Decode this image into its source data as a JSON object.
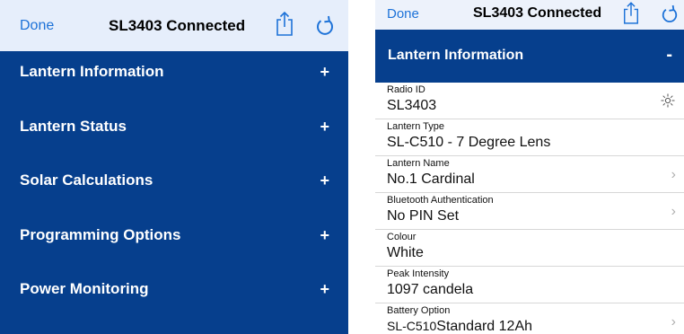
{
  "left": {
    "navbar": {
      "done": "Done",
      "title": "SL3403 Connected"
    },
    "sections": [
      {
        "label": "Lantern Information",
        "toggle": "+"
      },
      {
        "label": "Lantern Status",
        "toggle": "+"
      },
      {
        "label": "Solar Calculations",
        "toggle": "+"
      },
      {
        "label": "Programming Options",
        "toggle": "+"
      },
      {
        "label": "Power Monitoring",
        "toggle": "+"
      }
    ]
  },
  "right": {
    "navbar": {
      "done": "Done",
      "title": "SL3403 Connected"
    },
    "section": {
      "label": "Lantern Information",
      "toggle": "-"
    },
    "rows": [
      {
        "label": "Radio ID",
        "value": "SL3403",
        "accessory": "sun-icon"
      },
      {
        "label": "Lantern Type",
        "value": "SL-C510 - 7 Degree Lens"
      },
      {
        "label": "Lantern Name",
        "value": "No.1 Cardinal",
        "accessory": "chevron-right-icon"
      },
      {
        "label": "Bluetooth Authentication",
        "value": "No PIN Set",
        "accessory": "chevron-right-icon"
      },
      {
        "label": "Colour",
        "value": "White"
      },
      {
        "label": "Peak Intensity",
        "value": "1097 candela"
      },
      {
        "label": "Battery Option",
        "value_prefix": "SL-C510",
        "value": "Standard 12Ah",
        "accessory": "chevron-right-icon"
      }
    ]
  },
  "colors": {
    "brand": "#063f8d",
    "navbar": "#e6eefb",
    "link": "#1d72d8"
  }
}
